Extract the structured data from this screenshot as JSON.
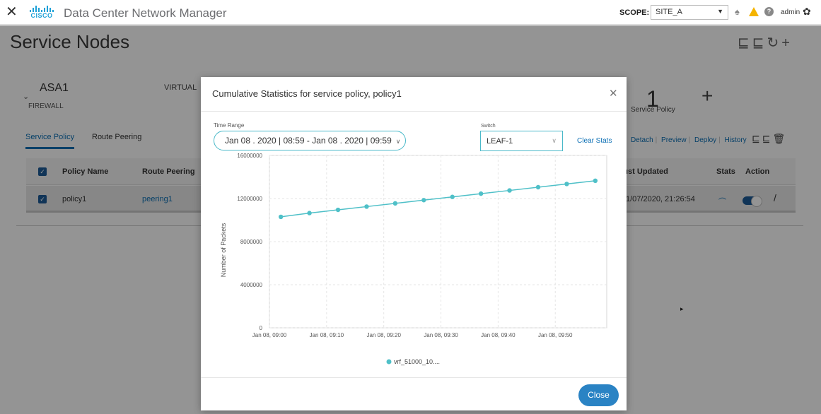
{
  "topbar": {
    "close_glyph": "✕",
    "cisco_word": "CISCO",
    "app_title": "Data Center Network Manager",
    "scope_label": "SCOPE:",
    "scope_value": "SITE_A",
    "user": "admin"
  },
  "page": {
    "title": "Service Nodes"
  },
  "node": {
    "name": "ASA1",
    "type": "FIREWALL",
    "attachment": "VIRTUAL",
    "policy_count": "1",
    "policy_count_label": "Service Policy",
    "tabs": [
      "Service Policy",
      "Route Peering"
    ],
    "actions": [
      "h",
      "Detach",
      "Preview",
      "Deploy",
      "History"
    ]
  },
  "table": {
    "headers": {
      "policy_name": "Policy Name",
      "route_peering": "Route Peering",
      "last_updated": "ıst Updated",
      "stats": "Stats",
      "action": "Action"
    },
    "rows": [
      {
        "policy_name": "policy1",
        "route_peering": "peering1",
        "last_updated": "1/07/2020, 21:26:54"
      }
    ]
  },
  "modal": {
    "title": "Cumulative Statistics for service policy, policy1",
    "time_range_label": "Time Range",
    "time_range_value": "Jan 08 . 2020 | 08:59 - Jan 08 . 2020 | 09:59",
    "switch_label": "Switch",
    "switch_value": "LEAF-1",
    "clear_stats": "Clear Stats",
    "close_button": "Close"
  },
  "colors": {
    "accent": "#0a6eb4",
    "series": "#4fc0c8",
    "close_button": "#2a83c4"
  },
  "chart_data": {
    "type": "line",
    "title": "",
    "xlabel": "",
    "ylabel": "Number of Packets",
    "x": [
      "09:02",
      "09:07",
      "09:12",
      "09:17",
      "09:22",
      "09:27",
      "09:32",
      "09:37",
      "09:42",
      "09:47",
      "09:52",
      "09:57"
    ],
    "x_tick_labels": [
      "Jan 08, 09:00",
      "Jan 08, 09:10",
      "Jan 08, 09:20",
      "Jan 08, 09:30",
      "Jan 08, 09:40",
      "Jan 08, 09:50"
    ],
    "y_tick_labels": [
      "0",
      "4000000",
      "8000000",
      "12000000",
      "16000000"
    ],
    "ylim": [
      0,
      16000000
    ],
    "xlim": [
      "09:00",
      "09:59"
    ],
    "grid": true,
    "legend_position": "bottom",
    "series": [
      {
        "name": "vrf_51000_10....",
        "values": [
          10300000,
          10650000,
          10950000,
          11250000,
          11550000,
          11850000,
          12150000,
          12450000,
          12750000,
          13050000,
          13350000,
          13650000
        ]
      }
    ]
  }
}
